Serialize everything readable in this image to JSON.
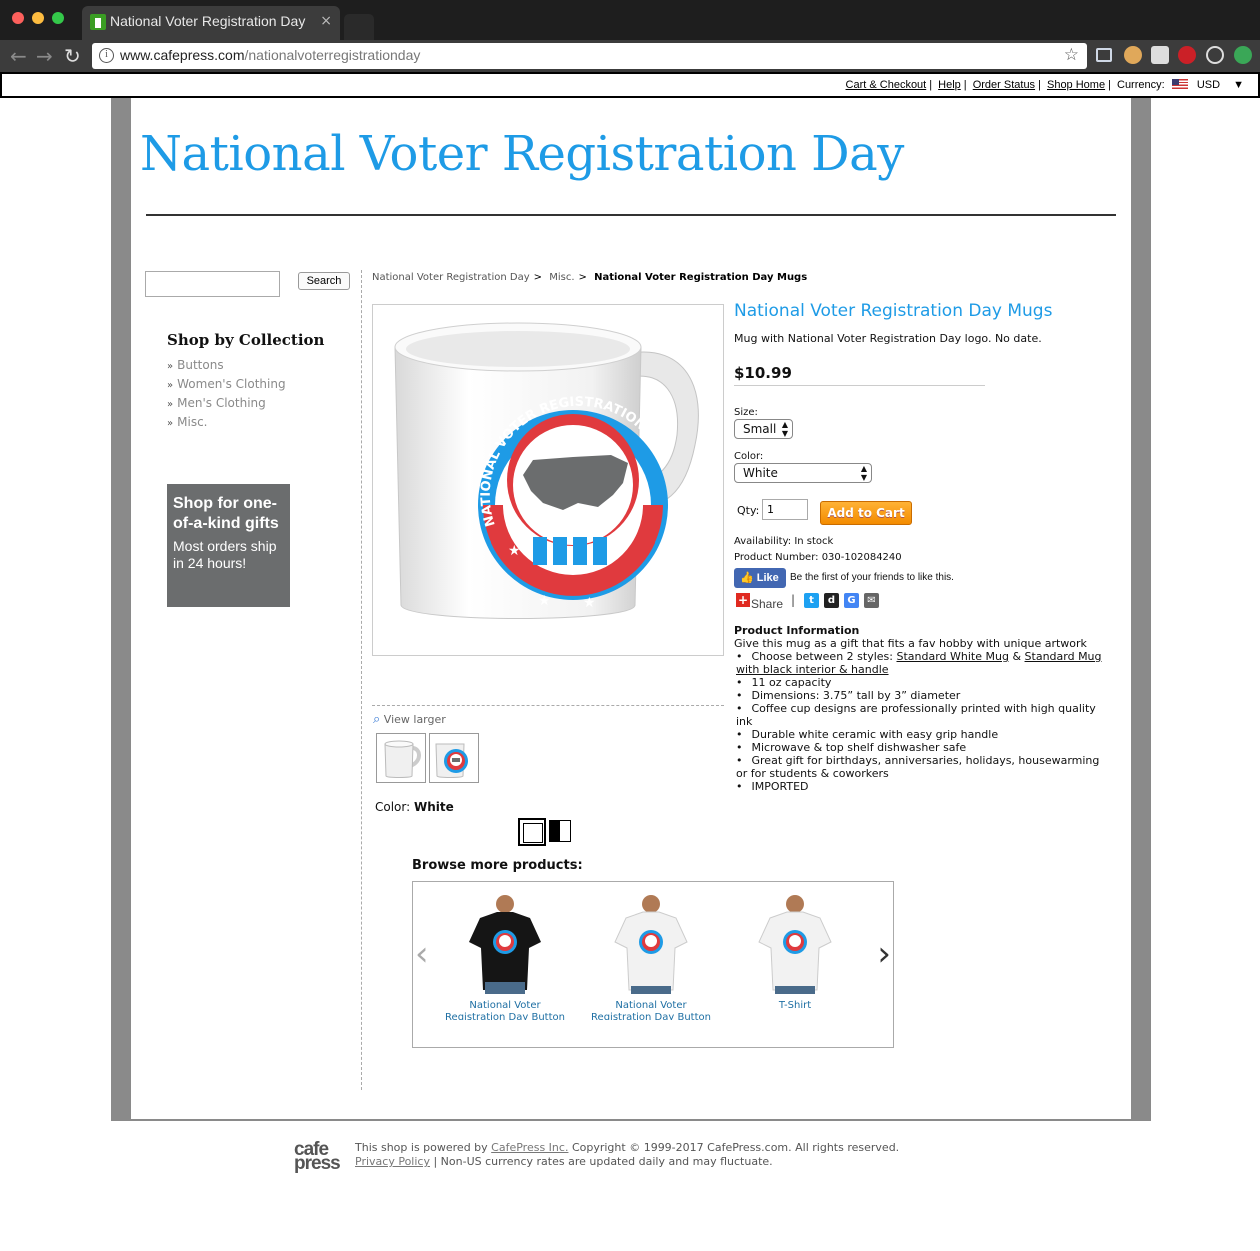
{
  "browser": {
    "tab_title": "National Voter Registration Day",
    "tab_close": "×",
    "url_host": "www.cafepress.com",
    "url_path": "/nationalvoterregistrationday",
    "info_icon": "i",
    "star_icon": "☆"
  },
  "utility": {
    "cart": "Cart & Checkout",
    "help": "Help",
    "order_status": "Order Status",
    "shop_home": "Shop Home",
    "currency_label": "Currency:",
    "currency_value": "USD",
    "currency_arrow": "▼",
    "sep": "|"
  },
  "site": {
    "title": "National Voter Registration Day"
  },
  "sidebar": {
    "search_button": "Search",
    "collection_title": "Shop by Collection",
    "bullet": "»",
    "items": [
      "Buttons",
      "Women's Clothing",
      "Men's Clothing",
      "Misc."
    ],
    "promo_heading": "Shop for one-of-a-kind gifts",
    "promo_sub": "Most orders ship in 24 hours!"
  },
  "breadcrumb": {
    "items": [
      "National Voter Registration Day",
      "Misc.",
      "National Voter Registration Day Mugs"
    ],
    "sep": ">"
  },
  "product": {
    "title": "National Voter Registration Day Mugs",
    "description": "Mug with National Voter Registration Day logo. No date.",
    "price": "$10.99",
    "size_label": "Size:",
    "size_value": "Small",
    "color_label": "Color:",
    "color_value": "White",
    "qty_label": "Qty:",
    "qty_value": "1",
    "add_to_cart": "Add to Cart",
    "availability": "Availability: In stock",
    "product_number": "Product Number: 030-102084240",
    "fb_like": "Like",
    "fb_text": "Be the first of your friends to like this.",
    "share": "Share",
    "share_sep": "|",
    "view_larger": "View larger",
    "image_color_label": "Color:",
    "image_color_value": "White",
    "mug_text": "NATIONAL VOTER REGISTRATION"
  },
  "product_info": {
    "heading": "Product Information",
    "intro": "Give this mug as a gift that fits a fav hobby with unique artwork",
    "styles_prefix": "Choose between 2 styles: ",
    "style_1": "Standard White Mug",
    "styles_amp": " & ",
    "style_2": "Standard Mug with black interior & handle",
    "bullets": [
      "11 oz capacity",
      "Dimensions: 3.75” tall by 3” diameter",
      "Coffee cup designs are professionally printed with high quality ink",
      "Durable white ceramic with easy grip handle",
      "Microwave & top shelf dishwasher safe",
      "Great gift for birthdays, anniversaries, holidays, housewarming or for students & coworkers",
      "IMPORTED"
    ]
  },
  "browse": {
    "heading": "Browse more products:",
    "prev": "‹",
    "next": "›",
    "items": [
      {
        "caption": "National Voter Registration Day Button",
        "shirt_color": "#151515"
      },
      {
        "caption": "National Voter Registration Day Button",
        "shirt_color": "#f2f2f2"
      },
      {
        "caption": "T-Shirt",
        "shirt_color": "#f2f2f2"
      }
    ]
  },
  "footer": {
    "logo_top": "cafe",
    "logo_bottom": "press",
    "powered": "This shop is powered by ",
    "cafepress_link": "CafePress Inc.",
    "copyright": " Copyright © 1999-2017 CafePress.com. All rights reserved.",
    "privacy": "Privacy Policy",
    "currency_note": " | Non-US currency rates are updated daily and may fluctuate."
  },
  "colors": {
    "accent_blue": "#1e9be6",
    "frame_gray": "#8a8a8a",
    "promo_gray": "#6b6d6e",
    "cart_orange": "#f38b00",
    "logo_red": "#e03a3e"
  }
}
